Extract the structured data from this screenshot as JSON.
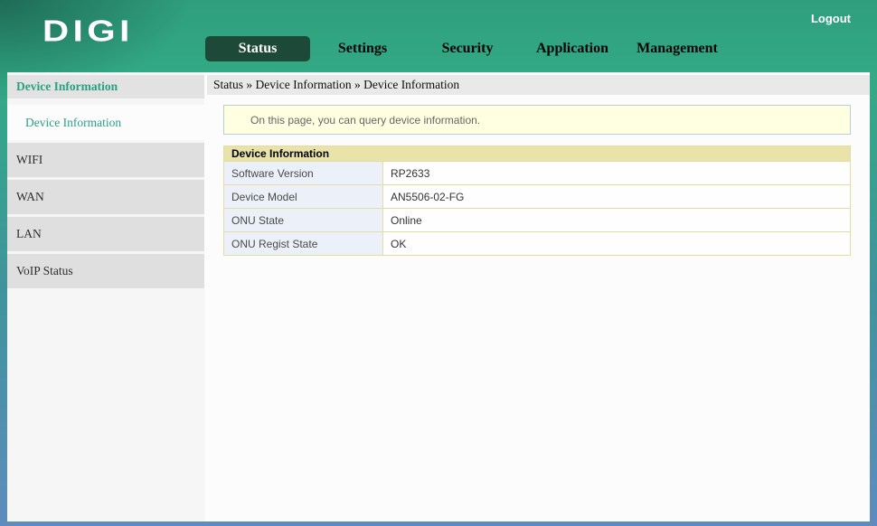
{
  "header": {
    "logo": "DIGI",
    "logout": "Logout",
    "nav": [
      {
        "label": "Status",
        "active": true
      },
      {
        "label": "Settings",
        "active": false
      },
      {
        "label": "Security",
        "active": false
      },
      {
        "label": "Application",
        "active": false
      },
      {
        "label": "Management",
        "active": false
      }
    ]
  },
  "sidebar": {
    "section": "Device Information",
    "active_item": "Device Information",
    "items": [
      "WIFI",
      "WAN",
      "LAN",
      "VoIP Status"
    ]
  },
  "breadcrumb": "Status » Device Information » Device Information",
  "info_message": "On this page, you can query device information.",
  "table": {
    "title": "Device Information",
    "rows": [
      {
        "label": "Software Version",
        "value": "RP2633"
      },
      {
        "label": "Device Model",
        "value": "AN5506-02-FG"
      },
      {
        "label": "ONU State",
        "value": "Online"
      },
      {
        "label": "ONU Regist State",
        "value": "OK"
      }
    ]
  },
  "colors": {
    "header_green_top": "#33aa85",
    "frame_blue_bottom": "#5e8cbd",
    "accent_teal": "#2aa183",
    "active_tab_bg": "#1d4a38",
    "table_header_bg": "#eae3a9",
    "table_border": "#e4dda1",
    "label_cell_bg": "#ebf0f9",
    "info_box_bg": "#ffffe1",
    "info_box_border": "#bacdd9",
    "breadcrumb_bg": "#e9e9e9",
    "sidebar_item_bg": "#dfdfdf"
  }
}
